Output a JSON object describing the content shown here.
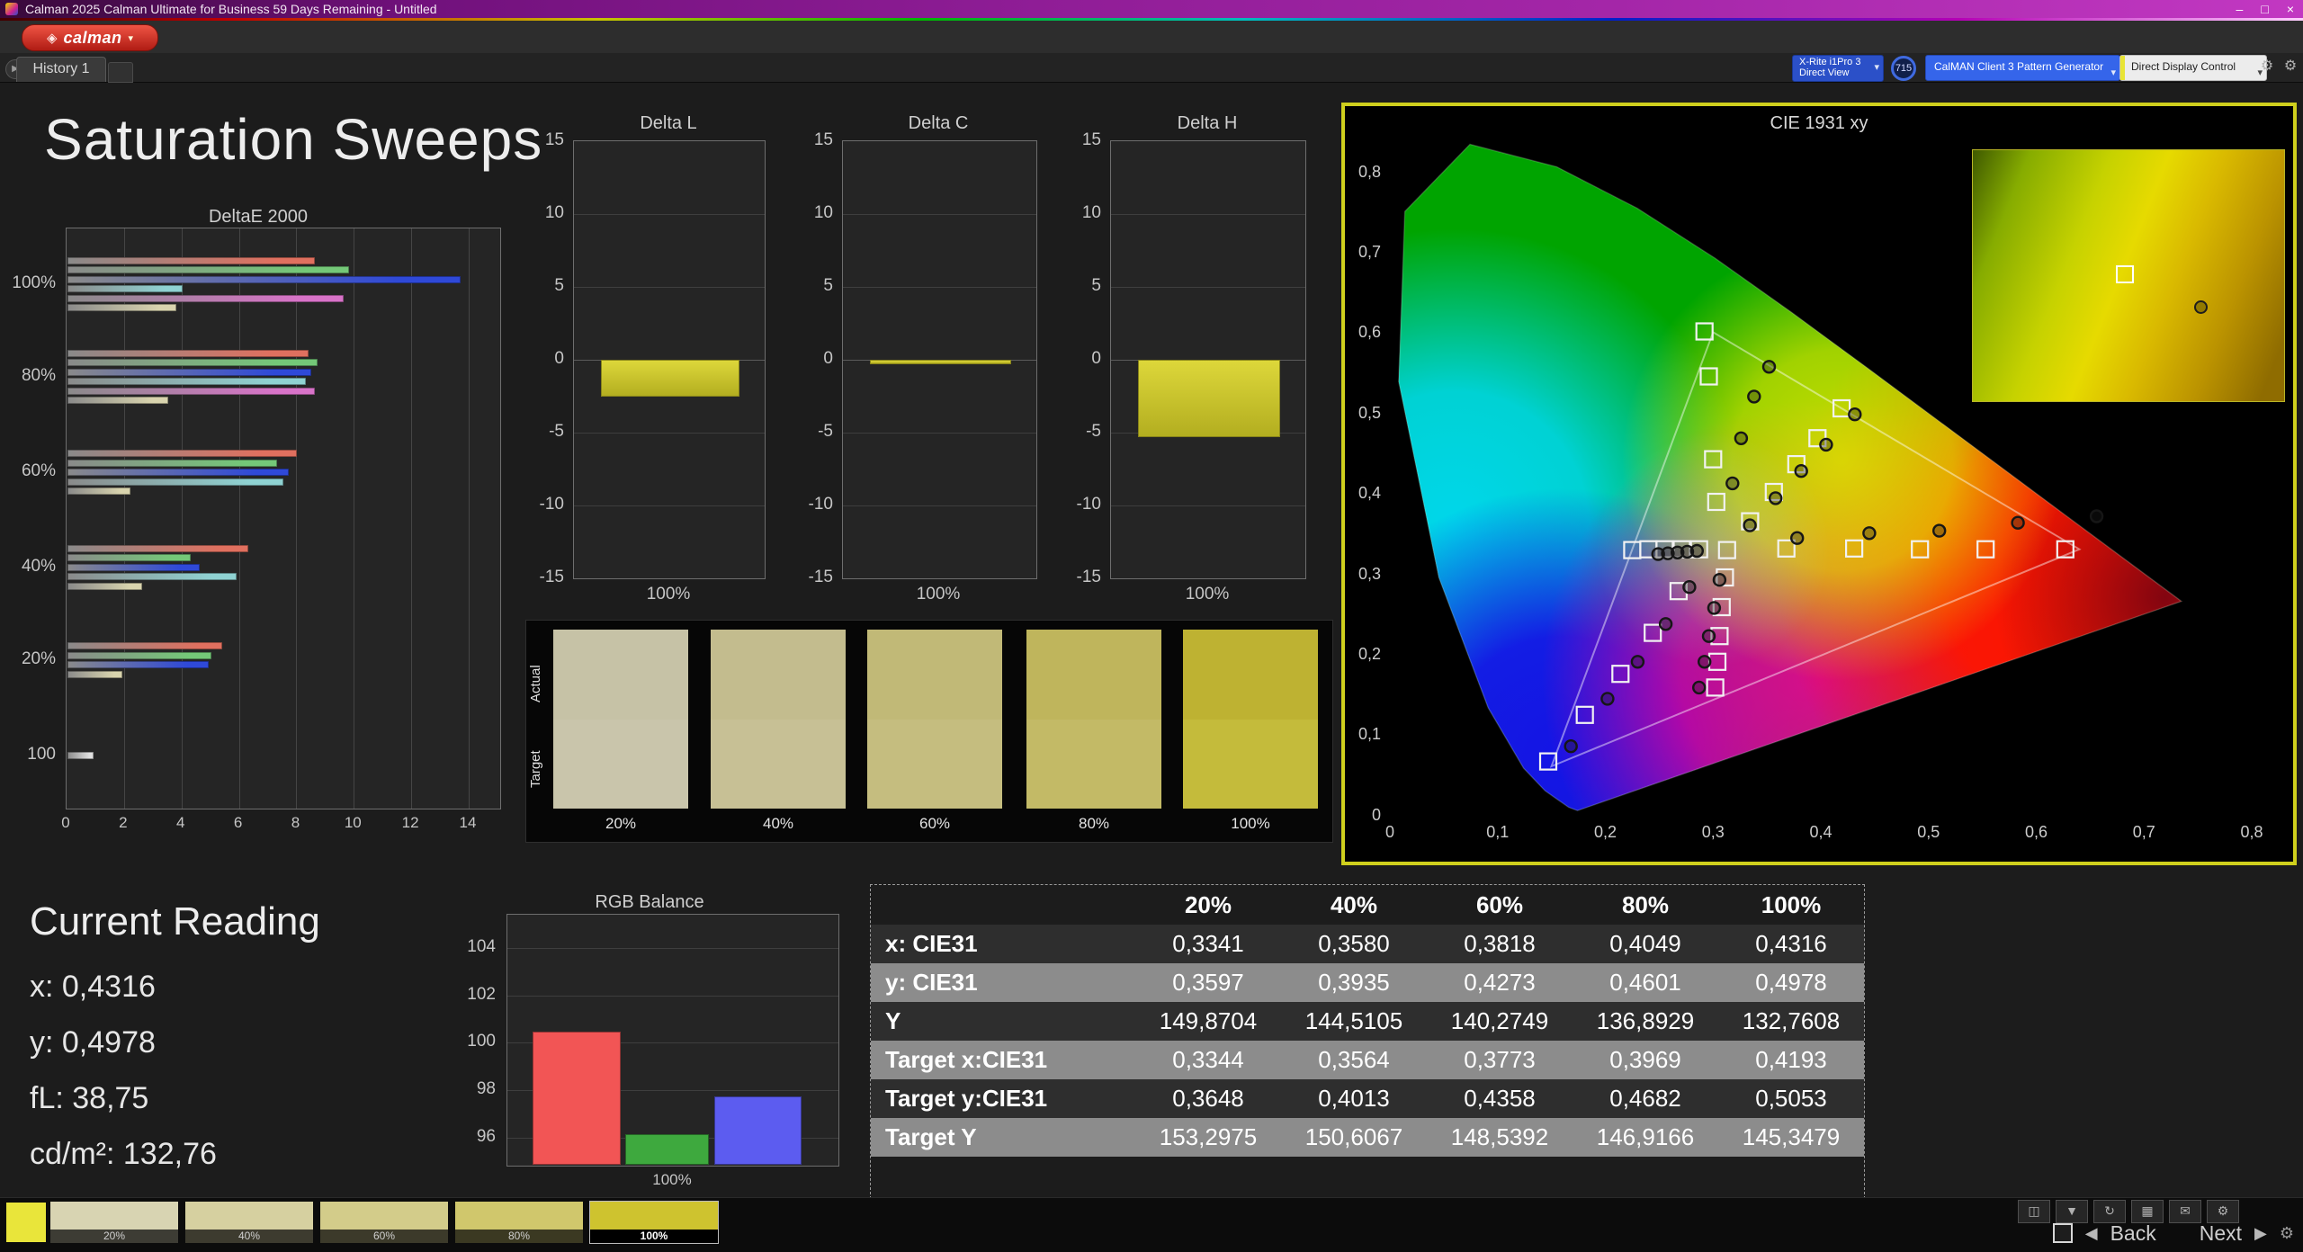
{
  "window": {
    "title": "Calman 2025 Calman Ultimate for Business 59 Days Remaining  - Untitled",
    "minimize": "–",
    "maximize": "□",
    "close": "×"
  },
  "app": {
    "logo_mark": "◈",
    "logo_text": "calman",
    "dropdown_glyph": "▾",
    "history_tab": "History 1",
    "play_glyph": "▶"
  },
  "toolbar": {
    "meter_line1": "X-Rite i1Pro 3",
    "meter_line2": "Direct View",
    "meter_badge": "715",
    "pattern_generator": "CalMAN Client 3 Pattern Generator",
    "display_control": "Direct Display Control",
    "dropdown_glyph": "▾",
    "gear_glyph": "⚙"
  },
  "page_title": "Saturation Sweeps",
  "current_reading": {
    "title": "Current Reading",
    "lines": [
      "x: 0,4316",
      "y: 0,4978",
      "fL: 38,75",
      "cd/m²: 132,76"
    ]
  },
  "swatch_compare": {
    "row_labels": [
      "Actual",
      "Target"
    ],
    "columns": [
      {
        "label": "20%",
        "actual": "#c6c2a6",
        "target": "#c9c5ab"
      },
      {
        "label": "40%",
        "actual": "#c3bc8e",
        "target": "#c7c095"
      },
      {
        "label": "60%",
        "actual": "#c1b977",
        "target": "#c5bd7f"
      },
      {
        "label": "80%",
        "actual": "#bfb55c",
        "target": "#c3ba66"
      },
      {
        "label": "100%",
        "actual": "#beb232",
        "target": "#c4bb3b"
      }
    ]
  },
  "table": {
    "columns": [
      "20%",
      "40%",
      "60%",
      "80%",
      "100%"
    ],
    "rows": [
      {
        "label": "x: CIE31",
        "values": [
          "0,3341",
          "0,3580",
          "0,3818",
          "0,4049",
          "0,4316"
        ]
      },
      {
        "label": "y: CIE31",
        "values": [
          "0,3597",
          "0,3935",
          "0,4273",
          "0,4601",
          "0,4978"
        ]
      },
      {
        "label": "Y",
        "values": [
          "149,8704",
          "144,5105",
          "140,2749",
          "136,8929",
          "132,7608"
        ]
      },
      {
        "label": "Target x:CIE31",
        "values": [
          "0,3344",
          "0,3564",
          "0,3773",
          "0,3969",
          "0,4193"
        ]
      },
      {
        "label": "Target y:CIE31",
        "values": [
          "0,3648",
          "0,4013",
          "0,4358",
          "0,4682",
          "0,5053"
        ]
      },
      {
        "label": "Target Y",
        "values": [
          "153,2975",
          "150,6067",
          "148,5392",
          "146,9166",
          "145,3479"
        ]
      }
    ]
  },
  "footer": {
    "current_patch_color": "#e9e53a",
    "thumbs": [
      {
        "label": "20%",
        "color": "#d8d4b2",
        "selected": false
      },
      {
        "label": "40%",
        "color": "#d6d0a0",
        "selected": false
      },
      {
        "label": "60%",
        "color": "#d3cc8a",
        "selected": false
      },
      {
        "label": "80%",
        "color": "#d0c76c",
        "selected": false
      },
      {
        "label": "100%",
        "color": "#cec32f",
        "selected": true
      }
    ],
    "small_buttons": [
      {
        "name": "layout-button",
        "glyph": "◫"
      },
      {
        "name": "save-report-button",
        "glyph": "▼"
      },
      {
        "name": "refresh-button",
        "glyph": "↻"
      },
      {
        "name": "grid-button",
        "glyph": "▦"
      },
      {
        "name": "export-button",
        "glyph": "✉"
      },
      {
        "name": "options-button",
        "glyph": "⚙"
      }
    ],
    "back_arrow": "◀",
    "back_label": "Back",
    "next_label": "Next",
    "next_arrow": "▶",
    "settings_glyph": "⚙"
  },
  "chart_data": [
    {
      "id": "deltaE2000",
      "type": "bar",
      "orientation": "horizontal",
      "title": "DeltaE 2000",
      "xlim": [
        0,
        14
      ],
      "xticks": [
        "0",
        "2",
        "4",
        "6",
        "8",
        "10",
        "12",
        "14"
      ],
      "bar_palette": [
        "#e0705f",
        "#74c878",
        "#2f49d8",
        "#8fd2d2",
        "#d873c8"
      ],
      "last_bar_color": "#d9d4ae",
      "groups": [
        {
          "label": "100%",
          "values": [
            8.6,
            9.8,
            13.7,
            4.0,
            9.6,
            3.8
          ]
        },
        {
          "label": "80%",
          "values": [
            8.4,
            8.7,
            8.5,
            8.3,
            8.6,
            3.5
          ]
        },
        {
          "label": "60%",
          "values": [
            8.0,
            7.3,
            7.7,
            7.5,
            2.2
          ]
        },
        {
          "label": "40%",
          "values": [
            6.3,
            4.3,
            4.6,
            5.9,
            2.6
          ]
        },
        {
          "label": "20%",
          "values": [
            5.4,
            5.0,
            4.9,
            1.9
          ]
        },
        {
          "label": "100",
          "values": [
            0.9
          ],
          "color": "#e0e0e0"
        }
      ]
    },
    {
      "id": "deltaL",
      "type": "bar",
      "title": "Delta L",
      "ylim": [
        -15,
        15
      ],
      "yticks": [
        "15",
        "10",
        "5",
        "0",
        "-5",
        "-10",
        "-15"
      ],
      "value": -2.4,
      "xlabel": "100%",
      "bar_color": "#cfc832"
    },
    {
      "id": "deltaC",
      "type": "bar",
      "title": "Delta C",
      "ylim": [
        -15,
        15
      ],
      "yticks": [
        "15",
        "10",
        "5",
        "0",
        "-5",
        "-10",
        "-15"
      ],
      "value": -0.15,
      "xlabel": "100%",
      "bar_color": "#cfc832"
    },
    {
      "id": "deltaH",
      "type": "bar",
      "title": "Delta H",
      "ylim": [
        -15,
        15
      ],
      "yticks": [
        "15",
        "10",
        "5",
        "0",
        "-5",
        "-10",
        "-15"
      ],
      "value": -5.2,
      "xlabel": "100%",
      "bar_color": "#cfc832"
    },
    {
      "id": "rgbBalance",
      "type": "bar",
      "title": "RGB Balance",
      "ylim": [
        94.9,
        105.4
      ],
      "yticks": [
        "104",
        "102",
        "100",
        "98",
        "96"
      ],
      "categories": [
        "Red",
        "Green",
        "Blue"
      ],
      "values": [
        100.5,
        96.2,
        97.8
      ],
      "colors": [
        "#f25555",
        "#3ea93e",
        "#5c5cf0"
      ],
      "xlabel": "100%"
    },
    {
      "id": "cie1931",
      "type": "scatter",
      "title": "CIE 1931 xy",
      "xlim": [
        0,
        0.8
      ],
      "ylim": [
        0,
        0.8
      ],
      "xticks": [
        "0",
        "0,1",
        "0,2",
        "0,3",
        "0,4",
        "0,5",
        "0,6",
        "0,7",
        "0,8"
      ],
      "yticks": [
        "0,8",
        "0,7",
        "0,6",
        "0,5",
        "0,4",
        "0,3",
        "0,2",
        "0,1",
        "0"
      ],
      "locus": [
        [
          0.1741,
          0.005
        ],
        [
          0.166,
          0.009
        ],
        [
          0.1566,
          0.0177
        ],
        [
          0.144,
          0.0297
        ],
        [
          0.1241,
          0.0578
        ],
        [
          0.0913,
          0.1327
        ],
        [
          0.0454,
          0.295
        ],
        [
          0.0082,
          0.5384
        ],
        [
          0.0139,
          0.7502
        ],
        [
          0.0743,
          0.8338
        ],
        [
          0.1547,
          0.8059
        ],
        [
          0.2296,
          0.7543
        ],
        [
          0.3016,
          0.6923
        ],
        [
          0.3731,
          0.6245
        ],
        [
          0.4441,
          0.5547
        ],
        [
          0.5125,
          0.4866
        ],
        [
          0.5752,
          0.4242
        ],
        [
          0.627,
          0.3725
        ],
        [
          0.6915,
          0.3083
        ],
        [
          0.7347,
          0.2653
        ]
      ],
      "srgb_triangle": [
        [
          0.64,
          0.33
        ],
        [
          0.3,
          0.6
        ],
        [
          0.15,
          0.06
        ]
      ],
      "targets_squares": [
        [
          0.313,
          0.329
        ],
        [
          0.368,
          0.331
        ],
        [
          0.431,
          0.331
        ],
        [
          0.492,
          0.33
        ],
        [
          0.553,
          0.33
        ],
        [
          0.627,
          0.33
        ],
        [
          0.3344,
          0.3648
        ],
        [
          0.3564,
          0.4013
        ],
        [
          0.3773,
          0.4358
        ],
        [
          0.3969,
          0.4682
        ],
        [
          0.4193,
          0.5053
        ],
        [
          0.303,
          0.389
        ],
        [
          0.3,
          0.442
        ],
        [
          0.296,
          0.545
        ],
        [
          0.292,
          0.601
        ],
        [
          0.287,
          0.33
        ],
        [
          0.271,
          0.33
        ],
        [
          0.255,
          0.33
        ],
        [
          0.24,
          0.33
        ],
        [
          0.225,
          0.329
        ],
        [
          0.268,
          0.278
        ],
        [
          0.244,
          0.226
        ],
        [
          0.214,
          0.175
        ],
        [
          0.181,
          0.124
        ],
        [
          0.147,
          0.066
        ],
        [
          0.311,
          0.295
        ],
        [
          0.308,
          0.258
        ],
        [
          0.306,
          0.222
        ],
        [
          0.304,
          0.19
        ],
        [
          0.302,
          0.158
        ]
      ],
      "measured_circles": [
        [
          0.3341,
          0.3597
        ],
        [
          0.358,
          0.3935
        ],
        [
          0.3818,
          0.4273
        ],
        [
          0.4049,
          0.4601
        ],
        [
          0.4316,
          0.4978
        ],
        [
          0.378,
          0.344
        ],
        [
          0.445,
          0.35
        ],
        [
          0.51,
          0.353
        ],
        [
          0.583,
          0.363
        ],
        [
          0.656,
          0.371
        ],
        [
          0.318,
          0.412
        ],
        [
          0.326,
          0.468
        ],
        [
          0.338,
          0.52
        ],
        [
          0.352,
          0.557
        ],
        [
          0.249,
          0.324
        ],
        [
          0.258,
          0.325
        ],
        [
          0.267,
          0.326
        ],
        [
          0.276,
          0.327
        ],
        [
          0.285,
          0.328
        ],
        [
          0.278,
          0.283
        ],
        [
          0.256,
          0.237
        ],
        [
          0.23,
          0.19
        ],
        [
          0.202,
          0.144
        ],
        [
          0.168,
          0.085
        ],
        [
          0.306,
          0.292
        ],
        [
          0.301,
          0.257
        ],
        [
          0.296,
          0.222
        ],
        [
          0.292,
          0.19
        ],
        [
          0.287,
          0.158
        ]
      ]
    }
  ]
}
